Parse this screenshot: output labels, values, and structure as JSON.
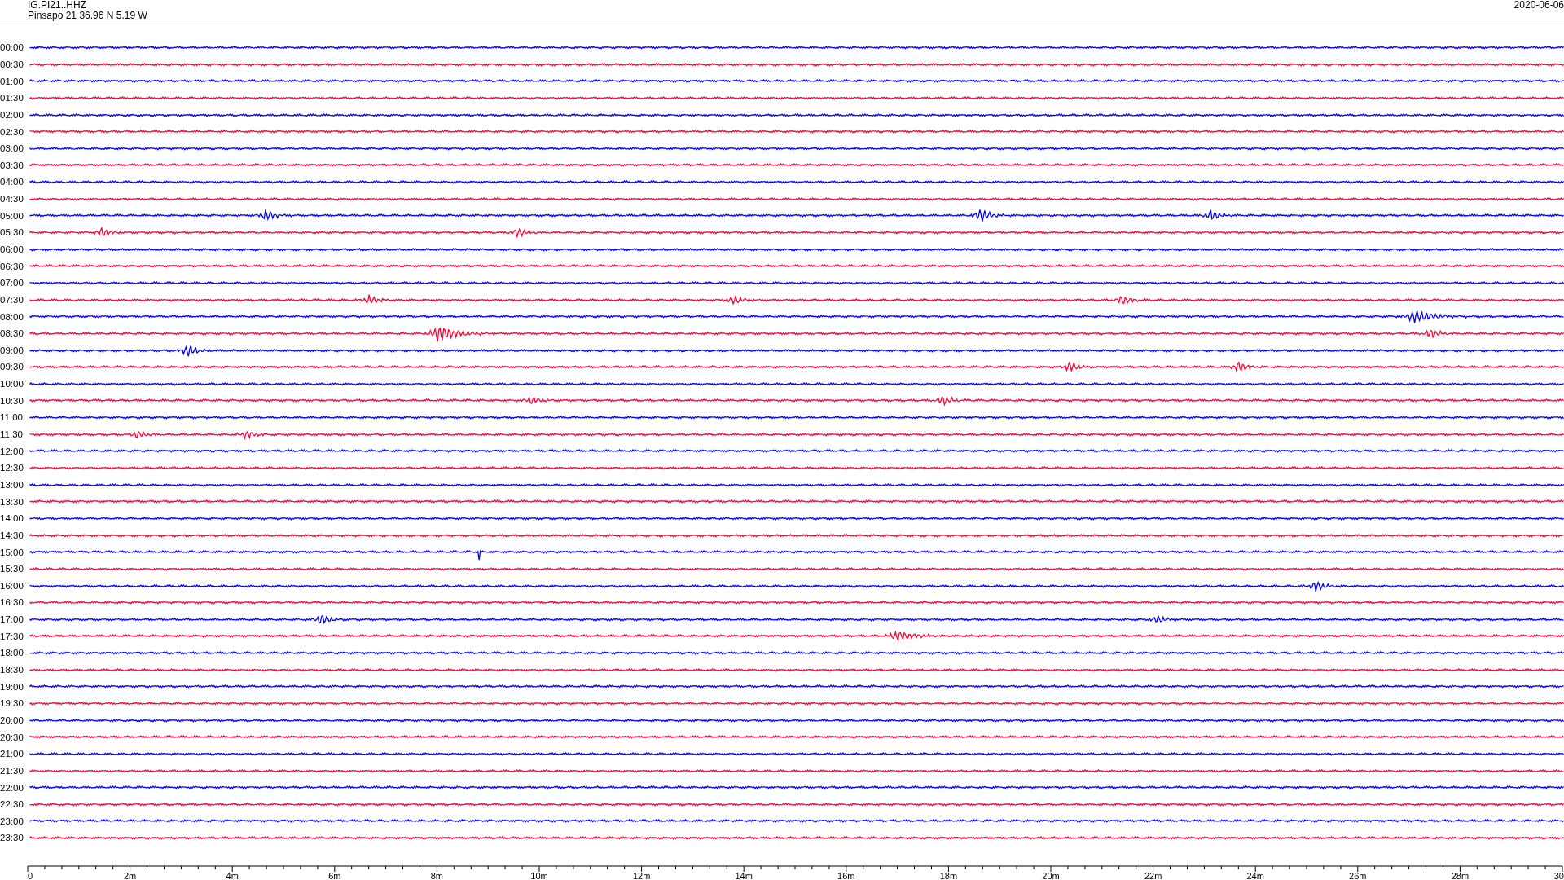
{
  "header": {
    "station": "IG.PI21..HHZ",
    "location": "Pinsapo 21  36.96 N 5.19 W",
    "date": "2020-06-06"
  },
  "rows": [
    {
      "label": "00:00",
      "color": "#0000ff"
    },
    {
      "label": "00:30",
      "color": "#ff0033"
    },
    {
      "label": "01:00",
      "color": "#0000ff"
    },
    {
      "label": "01:30",
      "color": "#ff0033"
    },
    {
      "label": "02:00",
      "color": "#0000ff"
    },
    {
      "label": "02:30",
      "color": "#ff0033"
    },
    {
      "label": "03:00",
      "color": "#0000ff"
    },
    {
      "label": "03:30",
      "color": "#ff0033"
    },
    {
      "label": "04:00",
      "color": "#0000ff"
    },
    {
      "label": "04:30",
      "color": "#ff0033"
    },
    {
      "label": "05:00",
      "color": "#0000ff"
    },
    {
      "label": "05:30",
      "color": "#ff0033"
    },
    {
      "label": "06:00",
      "color": "#0000ff"
    },
    {
      "label": "06:30",
      "color": "#ff0033"
    },
    {
      "label": "07:00",
      "color": "#0000ff"
    },
    {
      "label": "07:30",
      "color": "#ff0033"
    },
    {
      "label": "08:00",
      "color": "#0000ff"
    },
    {
      "label": "08:30",
      "color": "#ff0033"
    },
    {
      "label": "09:00",
      "color": "#0000ff"
    },
    {
      "label": "09:30",
      "color": "#ff0033"
    },
    {
      "label": "10:00",
      "color": "#0000ff"
    },
    {
      "label": "10:30",
      "color": "#ff0033"
    },
    {
      "label": "11:00",
      "color": "#0000ff"
    },
    {
      "label": "11:30",
      "color": "#ff0033"
    },
    {
      "label": "12:00",
      "color": "#0000ff"
    },
    {
      "label": "12:30",
      "color": "#ff0033"
    },
    {
      "label": "13:00",
      "color": "#0000ff"
    },
    {
      "label": "13:30",
      "color": "#ff0033"
    },
    {
      "label": "14:00",
      "color": "#0000ff"
    },
    {
      "label": "14:30",
      "color": "#ff0033"
    },
    {
      "label": "15:00",
      "color": "#0000ff"
    },
    {
      "label": "15:30",
      "color": "#ff0033"
    },
    {
      "label": "16:00",
      "color": "#0000ff"
    },
    {
      "label": "16:30",
      "color": "#ff0033"
    },
    {
      "label": "17:00",
      "color": "#0000ff"
    },
    {
      "label": "17:30",
      "color": "#ff0033"
    },
    {
      "label": "18:00",
      "color": "#0000ff"
    },
    {
      "label": "18:30",
      "color": "#ff0033"
    },
    {
      "label": "19:00",
      "color": "#0000ff"
    },
    {
      "label": "19:30",
      "color": "#ff0033"
    },
    {
      "label": "20:00",
      "color": "#0000ff"
    },
    {
      "label": "20:30",
      "color": "#ff0033"
    },
    {
      "label": "21:00",
      "color": "#0000ff"
    },
    {
      "label": "21:30",
      "color": "#ff0033"
    },
    {
      "label": "22:00",
      "color": "#0000ff"
    },
    {
      "label": "22:30",
      "color": "#ff0033"
    },
    {
      "label": "23:00",
      "color": "#0000ff"
    },
    {
      "label": "23:30",
      "color": "#ff0033"
    }
  ],
  "time_axis": {
    "labels": [
      "0",
      "2m",
      "4m",
      "6m",
      "8m",
      "10m",
      "12m",
      "14m",
      "16m",
      "18m",
      "20m",
      "22m",
      "24m",
      "26m",
      "28m",
      "30"
    ]
  }
}
